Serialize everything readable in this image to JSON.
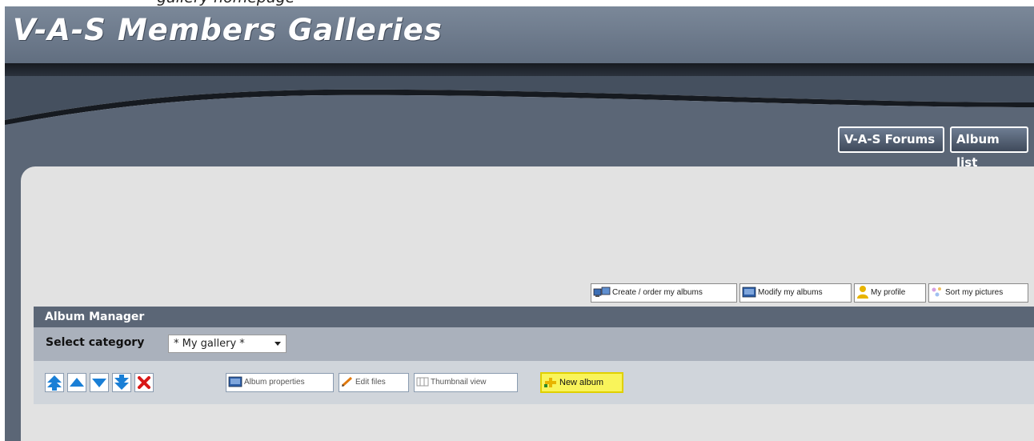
{
  "site": {
    "title": "V-A-S Members Galleries",
    "top_caption": "gallery homepage"
  },
  "nav": {
    "forums_label": "V-A-S Forums",
    "album_list_label": "Album list"
  },
  "actions": {
    "create_label": "Create / order my albums",
    "modify_label": "Modify my albums",
    "profile_label": "My profile",
    "sort_label": "Sort my pictures"
  },
  "album_manager": {
    "title": "Album Manager",
    "select_label": "Select category",
    "selected_category": "* My gallery *",
    "toolbar": {
      "icons": [
        "move-top-icon",
        "move-up-icon",
        "move-down-icon",
        "move-bottom-icon",
        "delete-icon"
      ],
      "album_properties_label": "Album properties",
      "edit_files_label": "Edit files",
      "thumbnail_view_label": "Thumbnail view",
      "new_album_label": "New album"
    }
  },
  "colors": {
    "header": "#6a778a",
    "panel": "#e2e2e2",
    "manager_header": "#5b6676",
    "new_album_highlight": "#f9f45a",
    "arrow_blue": "#1a7fd6",
    "delete_red": "#d81818"
  }
}
